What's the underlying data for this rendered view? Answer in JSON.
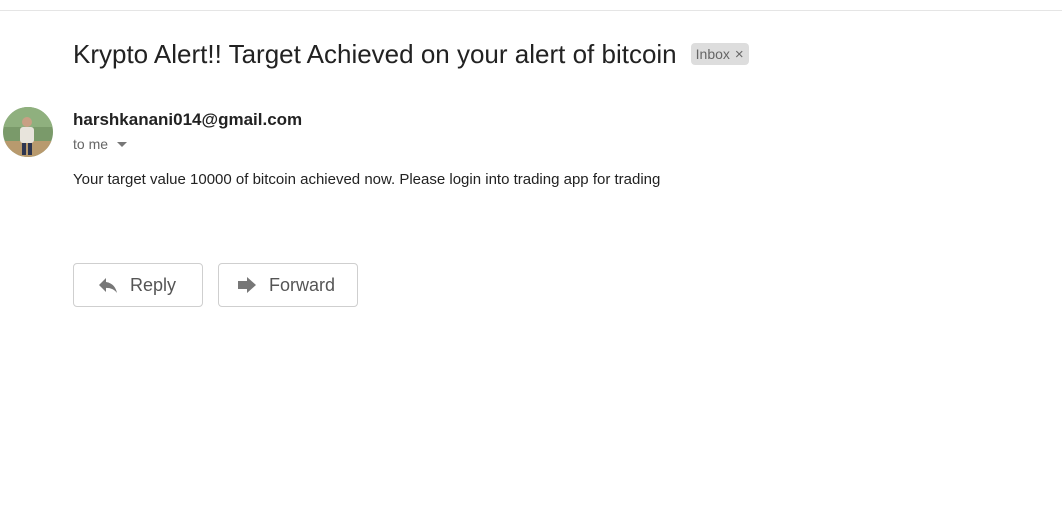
{
  "message": {
    "subject": "Krypto Alert!! Target Achieved on your alert of bitcoin",
    "label": "Inbox",
    "label_close": "×",
    "sender_email": "harshkanani014@gmail.com",
    "recipient_line": "to me",
    "body": "Your target value 10000 of bitcoin achieved now. Please login into trading app for trading"
  },
  "actions": {
    "reply_label": "Reply",
    "forward_label": "Forward"
  },
  "icons": {
    "reply": "reply-icon",
    "forward": "forward-icon",
    "caret": "chevron-down-icon",
    "avatar": "avatar"
  },
  "colors": {
    "text_primary": "#222222",
    "text_secondary": "#666666",
    "chip_background": "#dddddd",
    "button_border": "#cfcfcf",
    "icon_gray": "#777777"
  }
}
